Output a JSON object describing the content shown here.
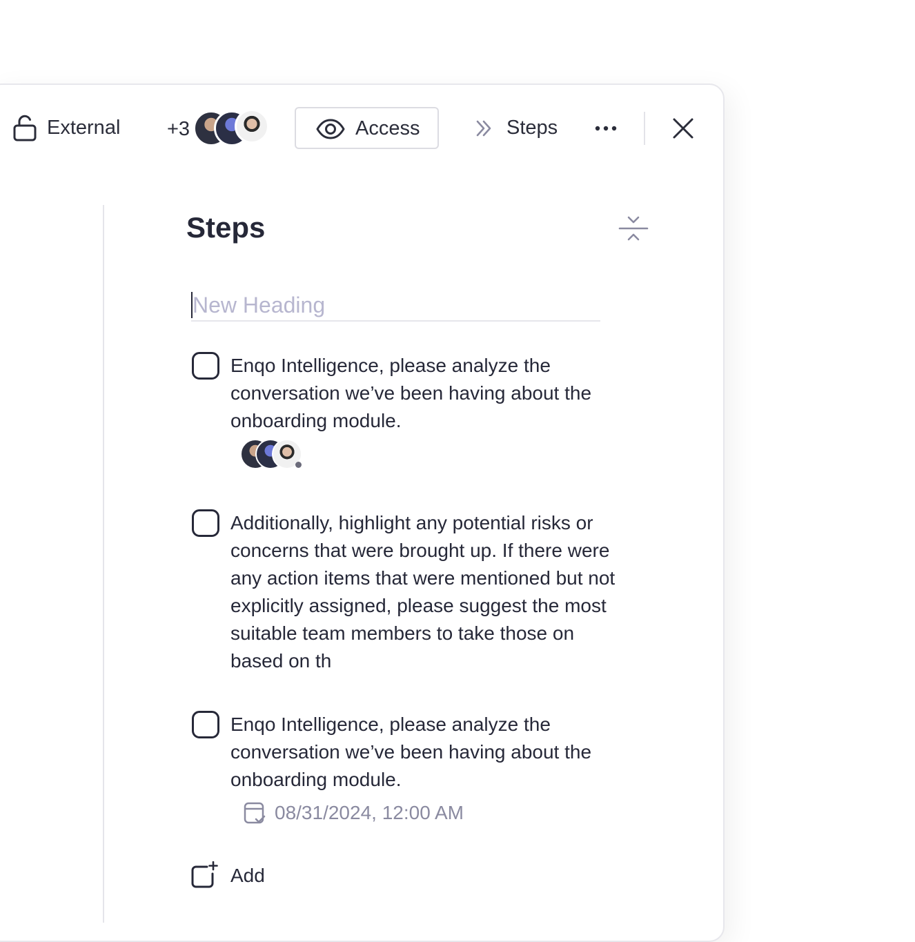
{
  "toolbar": {
    "external_label": "External",
    "extra_members": "+3",
    "access_label": "Access",
    "steps_label": "Steps"
  },
  "main": {
    "title": "Steps",
    "heading_placeholder": "New Heading",
    "steps": [
      {
        "text": "Enqo Intelligence, please analyze the conversation we’ve been having about the onboarding module."
      },
      {
        "text": "Additionally, highlight any potential risks or concerns that were brought up. If there were any action items that were mentioned but not explicitly assigned, please suggest the most suitable team members to take those on based on th"
      },
      {
        "text": "Enqo Intelligence, please analyze the conversation we’ve been having about the onboarding module.",
        "due_date": "08/31/2024, 12:00 AM"
      }
    ],
    "add_label": "Add"
  },
  "colors": {
    "text": "#262838",
    "muted": "#8a8aa0",
    "placeholder": "#b7b6cf",
    "border": "#e7e7ec"
  }
}
